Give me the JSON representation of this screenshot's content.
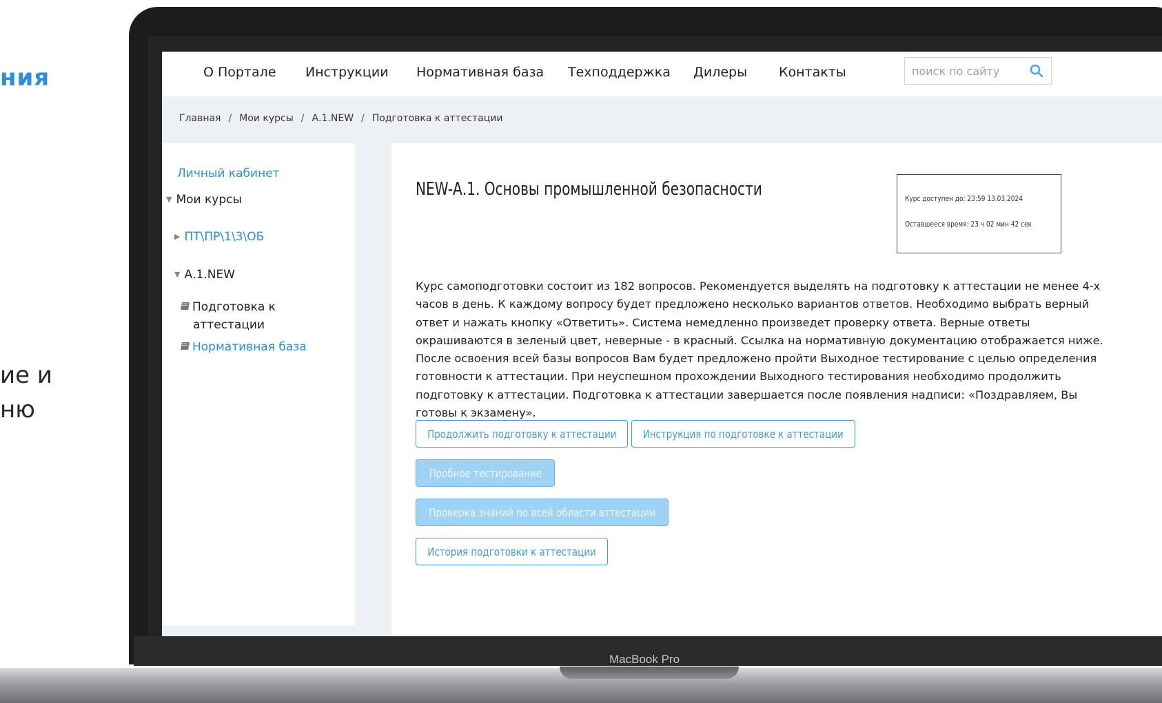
{
  "slide": {
    "heading_fragment": "ния",
    "text_fragment_1": "ие и",
    "text_fragment_2": "ню"
  },
  "device": {
    "label": "MacBook Pro"
  },
  "nav": {
    "items": [
      "О Портале",
      "Инструкции",
      "Нормативная база",
      "Техподдержка",
      "Дилеры",
      "Контакты"
    ],
    "search_placeholder": "поиск по сайту",
    "search_icon": "search-icon"
  },
  "breadcrumb": {
    "items": [
      "Главная",
      "Мои курсы",
      "А.1.NEW",
      "Подготовка к аттестации"
    ],
    "separator": "/"
  },
  "sidebar": {
    "personal_cabinet": "Личный кабинет",
    "my_courses": "Мои курсы",
    "course_1": "ПТ\\ПР\\1\\3\\ОБ",
    "course_2": "А.1.NEW",
    "item_prep_line1": "Подготовка к",
    "item_prep_line2": "аттестации",
    "item_norm": "Нормативная база"
  },
  "main": {
    "title": "NEW-А.1. Основы промышленной безопасности",
    "access_until": "Курс доступен до: 23:59 13.03.2024",
    "time_left": "Оставшееся время: 23 ч 02 мин 42 сек",
    "description": "Курс самоподготовки состоит из 182 вопросов. Рекомендуется выделять на подготовку к аттестации не менее 4-х часов в день. К каждому вопросу будет предложено несколько вариантов ответов. Необходимо выбрать верный ответ и нажать кнопку «Ответить». Система немедленно произведет проверку ответа. Верные ответы окрашиваются в зеленый цвет, неверные - в красный. Ссылка на нормативную документацию отображается ниже. После освоения всей базы вопросов Вам будет предложено пройти Выходное тестирование с целью определения готовности к аттестации. При неуспешном прохождении Выходного тестирования необходимо продолжить подготовку к аттестации. Подготовка к аттестации завершается после появления надписи: «Поздравляем, Вы готовы к экзамену».",
    "buttons": {
      "continue": "Продолжить подготовку к аттестации",
      "instruction": "Инструкция по подготовке к аттестации",
      "trial": "Пробное тестирование",
      "full_check": "Проверка знаний по всей области аттестации",
      "history": "История подготовки к аттестации"
    }
  },
  "colors": {
    "accent": "#2a8fd6",
    "button_border": "#3f9ae0",
    "button_disabled_bg": "#9fd3f6",
    "band_bg": "#edf1f5"
  }
}
